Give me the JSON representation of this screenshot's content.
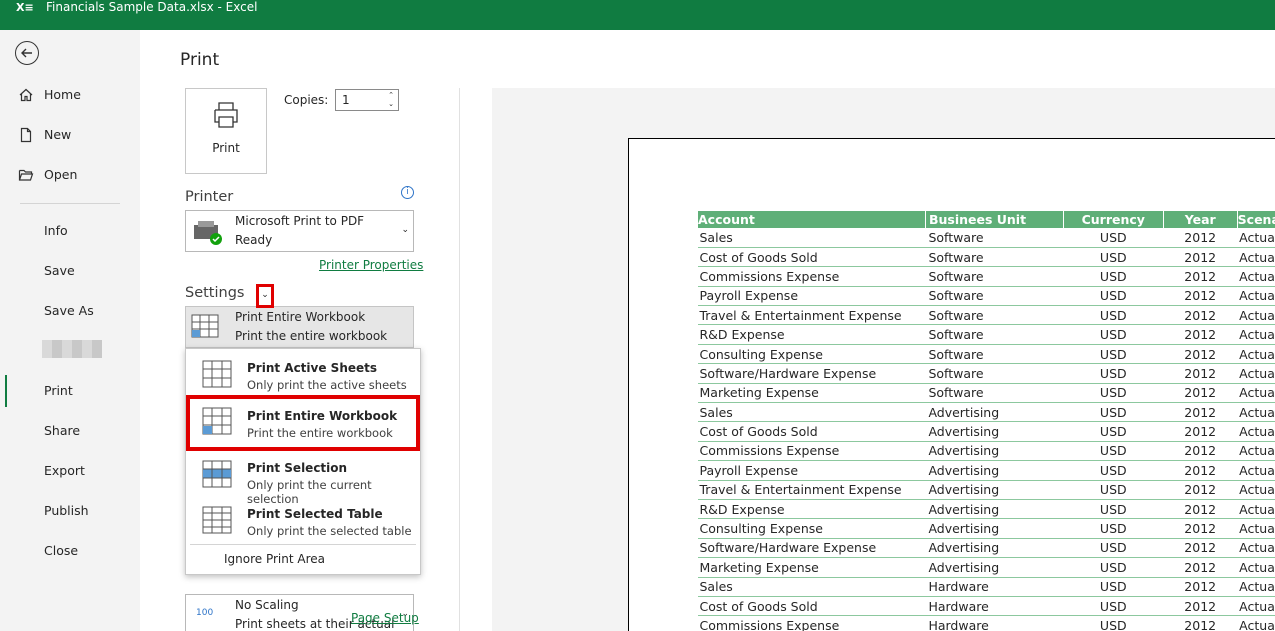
{
  "window": {
    "title": "Financials Sample Data.xlsx  -  Excel",
    "app_icon": "excel-icon"
  },
  "nav": {
    "items": [
      {
        "label": "Home",
        "icon": "home-icon"
      },
      {
        "label": "New",
        "icon": "new-document-icon"
      },
      {
        "label": "Open",
        "icon": "folder-open-icon"
      },
      {
        "label": "Info"
      },
      {
        "label": "Save"
      },
      {
        "label": "Save As"
      },
      {
        "label": "Print"
      },
      {
        "label": "Share"
      },
      {
        "label": "Export"
      },
      {
        "label": "Publish"
      },
      {
        "label": "Close"
      }
    ],
    "active": "Print"
  },
  "print": {
    "heading": "Print",
    "button_label": "Print",
    "copies_label": "Copies:",
    "copies_value": "1",
    "printer_heading": "Printer",
    "printer_name": "Microsoft Print to PDF",
    "printer_status": "Ready",
    "printer_properties": "Printer Properties",
    "settings_heading": "Settings",
    "setting_title": "Print Entire Workbook",
    "setting_sub": "Print the entire workbook",
    "scaling_title": "No Scaling",
    "scaling_sub": "Print sheets at their actual size",
    "scaling_badge": "100",
    "page_setup": "Page Setup"
  },
  "menu": {
    "items": [
      {
        "title": "Print Active Sheets",
        "sub": "Only print the active sheets"
      },
      {
        "title": "Print Entire Workbook",
        "sub": "Print the entire workbook",
        "highlighted": true
      },
      {
        "title": "Print Selection",
        "sub": "Only print the current selection"
      },
      {
        "title": "Print Selected Table",
        "sub": "Only print the selected table"
      }
    ],
    "ignore": "Ignore Print Area"
  },
  "preview": {
    "headers": [
      "Account",
      "Businees Unit",
      "Currency",
      "Year",
      "Scenario"
    ],
    "rows": [
      [
        "Sales",
        "Software",
        "USD",
        "2012",
        "Actuals"
      ],
      [
        "Cost of Goods Sold",
        "Software",
        "USD",
        "2012",
        "Actuals"
      ],
      [
        "Commissions Expense",
        "Software",
        "USD",
        "2012",
        "Actuals"
      ],
      [
        "Payroll Expense",
        "Software",
        "USD",
        "2012",
        "Actuals"
      ],
      [
        "Travel & Entertainment Expense",
        "Software",
        "USD",
        "2012",
        "Actuals"
      ],
      [
        "R&D Expense",
        "Software",
        "USD",
        "2012",
        "Actuals"
      ],
      [
        "Consulting Expense",
        "Software",
        "USD",
        "2012",
        "Actuals"
      ],
      [
        "Software/Hardware Expense",
        "Software",
        "USD",
        "2012",
        "Actuals"
      ],
      [
        "Marketing Expense",
        "Software",
        "USD",
        "2012",
        "Actuals"
      ],
      [
        "Sales",
        "Advertising",
        "USD",
        "2012",
        "Actuals"
      ],
      [
        "Cost of Goods Sold",
        "Advertising",
        "USD",
        "2012",
        "Actuals"
      ],
      [
        "Commissions Expense",
        "Advertising",
        "USD",
        "2012",
        "Actuals"
      ],
      [
        "Payroll Expense",
        "Advertising",
        "USD",
        "2012",
        "Actuals"
      ],
      [
        "Travel & Entertainment Expense",
        "Advertising",
        "USD",
        "2012",
        "Actuals"
      ],
      [
        "R&D Expense",
        "Advertising",
        "USD",
        "2012",
        "Actuals"
      ],
      [
        "Consulting Expense",
        "Advertising",
        "USD",
        "2012",
        "Actuals"
      ],
      [
        "Software/Hardware Expense",
        "Advertising",
        "USD",
        "2012",
        "Actuals"
      ],
      [
        "Marketing Expense",
        "Advertising",
        "USD",
        "2012",
        "Actuals"
      ],
      [
        "Sales",
        "Hardware",
        "USD",
        "2012",
        "Actuals"
      ],
      [
        "Cost of Goods Sold",
        "Hardware",
        "USD",
        "2012",
        "Actuals"
      ],
      [
        "Commissions Expense",
        "Hardware",
        "USD",
        "2012",
        "Actuals"
      ]
    ]
  },
  "colors": {
    "accent": "#107c41",
    "highlight": "#e00000",
    "table_header": "#5faf78"
  }
}
